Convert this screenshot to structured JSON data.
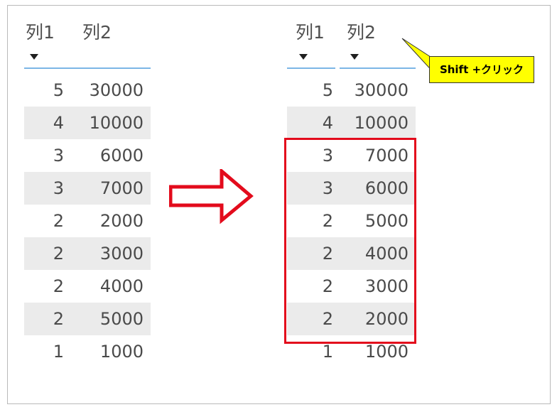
{
  "left_table": {
    "headers": [
      "列1",
      "列2"
    ],
    "rows": [
      {
        "c1": "5",
        "c2": "30000"
      },
      {
        "c1": "4",
        "c2": "10000"
      },
      {
        "c1": "3",
        "c2": "6000"
      },
      {
        "c1": "3",
        "c2": "7000"
      },
      {
        "c1": "2",
        "c2": "2000"
      },
      {
        "c1": "2",
        "c2": "3000"
      },
      {
        "c1": "2",
        "c2": "4000"
      },
      {
        "c1": "2",
        "c2": "5000"
      },
      {
        "c1": "1",
        "c2": "1000"
      }
    ]
  },
  "right_table": {
    "headers": [
      "列1",
      "列2"
    ],
    "rows": [
      {
        "c1": "5",
        "c2": "30000"
      },
      {
        "c1": "4",
        "c2": "10000"
      },
      {
        "c1": "3",
        "c2": "7000"
      },
      {
        "c1": "3",
        "c2": "6000"
      },
      {
        "c1": "2",
        "c2": "5000"
      },
      {
        "c1": "2",
        "c2": "4000"
      },
      {
        "c1": "2",
        "c2": "3000"
      },
      {
        "c1": "2",
        "c2": "2000"
      },
      {
        "c1": "1",
        "c2": "1000"
      }
    ]
  },
  "callout": {
    "text": "Shift +クリック"
  },
  "colors": {
    "highlight": "#e30b1c",
    "callout_bg": "#ffff00",
    "underline": "#7cb6e6",
    "shade": "#ebebeb"
  }
}
